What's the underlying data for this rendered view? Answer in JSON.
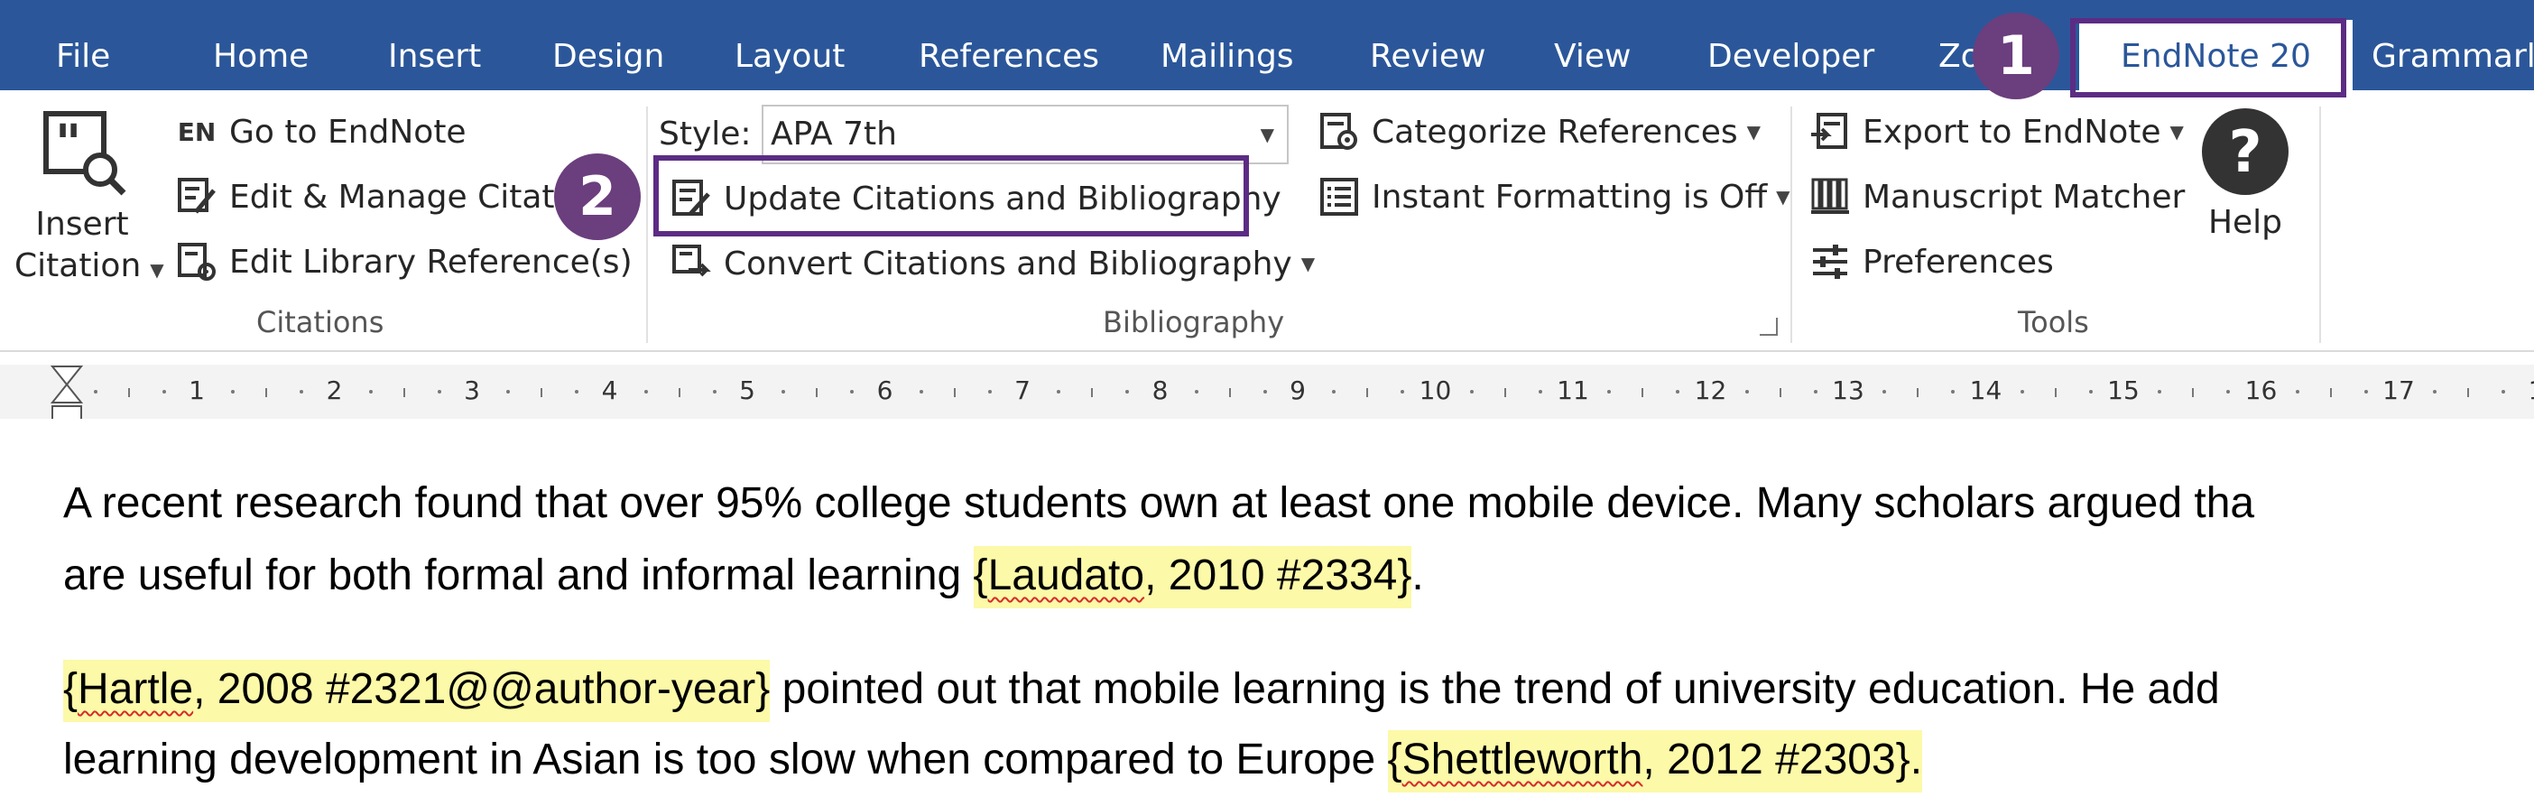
{
  "tabs": [
    {
      "label": "File",
      "active": false
    },
    {
      "label": "Home",
      "active": false
    },
    {
      "label": "Insert",
      "active": false
    },
    {
      "label": "Design",
      "active": false
    },
    {
      "label": "Layout",
      "active": false
    },
    {
      "label": "References",
      "active": false
    },
    {
      "label": "Mailings",
      "active": false
    },
    {
      "label": "Review",
      "active": false
    },
    {
      "label": "View",
      "active": false
    },
    {
      "label": "Developer",
      "active": false
    },
    {
      "label": "Zo",
      "active": false
    },
    {
      "label": "EndNote 20",
      "active": true
    },
    {
      "label": "Grammarly",
      "active": false
    }
  ],
  "ribbon": {
    "citations": {
      "insert_citation_line1": "Insert",
      "insert_citation_line2": "Citation",
      "go_to_endnote": "Go to EndNote",
      "edit_manage_citations": "Edit & Manage Citatio",
      "edit_library_references": "Edit Library Reference(s)",
      "group_label": "Citations"
    },
    "bibliography": {
      "style_label": "Style:",
      "style_value": "APA 7th",
      "update_citations": "Update Citations and Bibliography",
      "convert_citations": "Convert Citations and Bibliography",
      "categorize_references": "Categorize References",
      "instant_formatting": "Instant Formatting is Off",
      "group_label": "Bibliography"
    },
    "tools": {
      "export_to_endnote": "Export to EndNote",
      "manuscript_matcher": "Manuscript Matcher",
      "preferences": "Preferences",
      "help": "Help",
      "group_label": "Tools"
    },
    "icons": {
      "en_badge": "EN"
    }
  },
  "callouts": {
    "step1": "1",
    "step2": "2",
    "color": "#5c2c84"
  },
  "ruler": {
    "numbers": [
      "1",
      "2",
      "3",
      "4",
      "5",
      "6",
      "7",
      "8",
      "9",
      "10",
      "11",
      "12",
      "13",
      "14",
      "15",
      "16",
      "17",
      "1"
    ]
  },
  "document": {
    "para1_line1": "A recent research found that over 95% college students own at least one mobile device.  Many scholars argued tha",
    "para1_line2_pre": "are useful for both formal and informal learning ",
    "para1_cite_open": "{",
    "para1_cite_name": "Laudato",
    "para1_cite_rest": ", 2010 #2334}",
    "para1_line2_post": ".",
    "para2_cite_open": "{",
    "para2_cite_name": "Hartle",
    "para2_cite_rest": ", 2008 #2321@@author-year}",
    "para2_line1_post": " pointed out that mobile learning is the trend of university education.  He add",
    "para2_line2_pre": "learning development in Asian is too slow when compared to Europe ",
    "para2_cite2_open": "{",
    "para2_cite2_name": "Shettleworth",
    "para2_cite2_rest": ", 2012 #2303}."
  },
  "colors": {
    "tab_bar": "#2b579a",
    "citation_highlight": "#fcf9a8",
    "callout": "#6b3e7e"
  }
}
